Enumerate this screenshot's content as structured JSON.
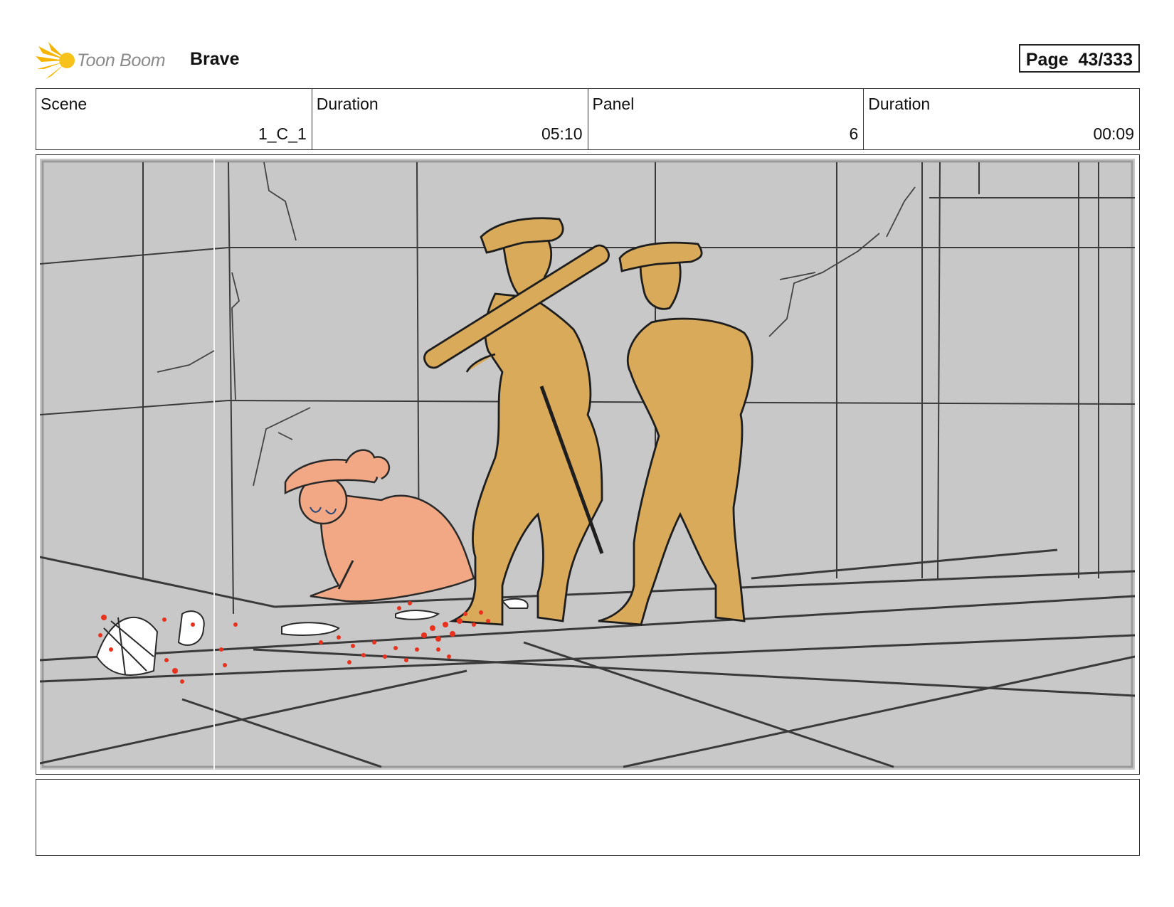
{
  "header": {
    "logo_text": "Toon Boom",
    "project_title": "Brave",
    "page_label": "Page",
    "page_number": "43/333"
  },
  "info": {
    "scene_label": "Scene",
    "scene_value": "1_C_1",
    "scene_duration_label": "Duration",
    "scene_duration_value": "05:10",
    "panel_label": "Panel",
    "panel_value": "6",
    "panel_duration_label": "Duration",
    "panel_duration_value": "00:09"
  },
  "colors": {
    "logo_accent": "#f5b400",
    "background_grey": "#c8c8c9",
    "soldier_fill": "#d9aa5a",
    "girl_fill": "#f2a884",
    "splatter": "#e8321e"
  },
  "notes": {
    "text": ""
  }
}
